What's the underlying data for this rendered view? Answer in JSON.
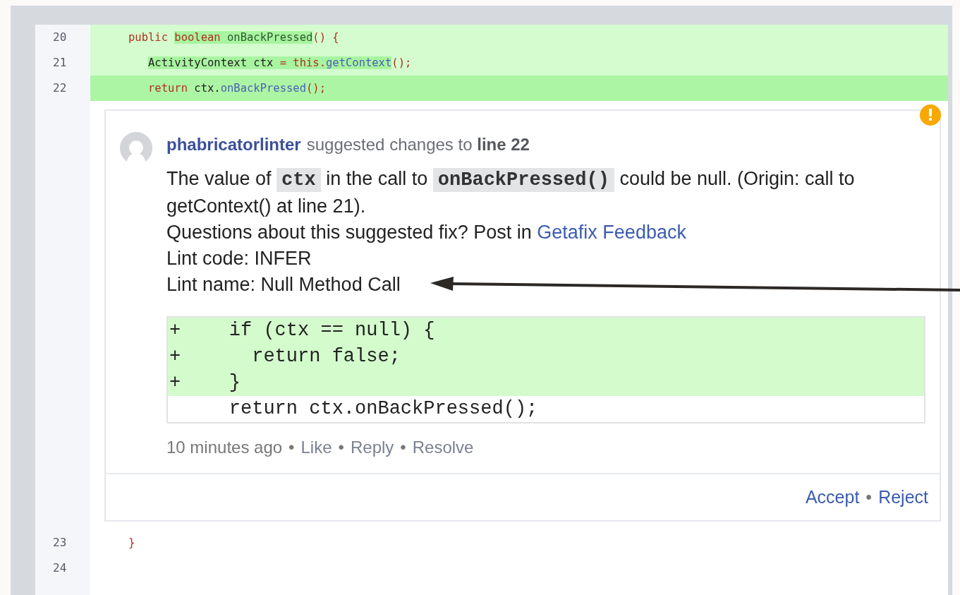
{
  "code_lines_before": [
    {
      "number": "20",
      "kind": "added",
      "tokens": [
        {
          "text": "public ",
          "kind": "keyword",
          "highlight": false
        },
        {
          "text": "boolean ",
          "kind": "keyword",
          "highlight": true
        },
        {
          "text": "onBackPressed",
          "kind": "declaration",
          "highlight": true
        },
        {
          "text": "() {",
          "kind": "keyword",
          "highlight": false
        }
      ]
    },
    {
      "number": "21",
      "kind": "added",
      "tokens": [
        {
          "text": "   ActivityContext ctx ",
          "kind": "plain",
          "highlight": true
        },
        {
          "text": "= this.",
          "kind": "keyword",
          "highlight": true
        },
        {
          "text": "getContext",
          "kind": "method",
          "highlight": true
        },
        {
          "text": "();",
          "kind": "keyword",
          "highlight": false
        }
      ]
    },
    {
      "number": "22",
      "kind": "focus",
      "tokens": [
        {
          "text": "   return ",
          "kind": "keyword"
        },
        {
          "text": "ctx.",
          "kind": "plain"
        },
        {
          "text": "onBackPressed",
          "kind": "method"
        },
        {
          "text": "();",
          "kind": "keyword"
        }
      ]
    }
  ],
  "comment": {
    "author": "phabricatorlinter",
    "header": "suggested changes to **line 22**",
    "message": [
      {
        "kind": "text",
        "text": "The value of"
      },
      {
        "kind": "code",
        "text": "ctx"
      },
      {
        "kind": "text",
        "text": "in the call to"
      },
      {
        "kind": "code",
        "text": "onBackPressed()"
      },
      {
        "kind": "text",
        "text": "could be null. (Origin: call to"
      },
      {
        "kind": "text",
        "text": "getContext() at line 21)."
      }
    ],
    "question": "Questions about this suggested fix? Post in",
    "question_link": "Getafix Feedback",
    "lint_code": "Lint code: INFER",
    "lint_name": "Lint name: Null Method Call",
    "suggestion": [
      {
        "kind": "added",
        "marker": "+",
        "text": "    if (ctx == null) {"
      },
      {
        "kind": "added",
        "marker": "+",
        "text": "      return false;"
      },
      {
        "kind": "added",
        "marker": "+",
        "text": "    }"
      },
      {
        "kind": "context",
        "text": "    return ctx.onBackPressed();"
      }
    ],
    "time": "10 minutes ago",
    "separator": "•",
    "actions": [
      "Like",
      "Reply",
      "Resolve"
    ],
    "decisions": [
      "Accept",
      "Reject"
    ]
  },
  "code_lines_after": [
    {
      "number": "23",
      "tokens": [
        {
          "text": "}",
          "kind": "keyword"
        }
      ]
    },
    {
      "number": "24"
    }
  ]
}
